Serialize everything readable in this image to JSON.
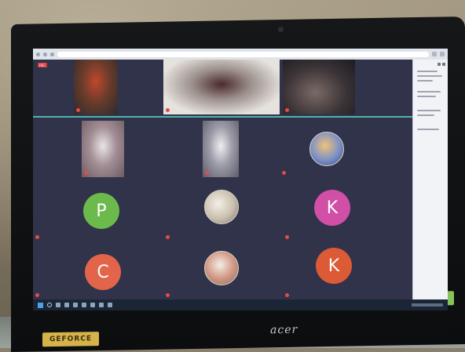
{
  "screen": {
    "recording_badge": "REC"
  },
  "participants": [
    {
      "kind": "video",
      "name": "",
      "video_color": "#6a3c2a"
    },
    {
      "kind": "video",
      "name": "",
      "video_color": "#cfcac4"
    },
    {
      "kind": "video",
      "name": "",
      "video_color": "#3b3336"
    },
    {
      "kind": "video",
      "name": "",
      "video_color": "#6e5b62"
    },
    {
      "kind": "video",
      "name": "",
      "video_color": "#5d5c6a"
    },
    {
      "kind": "photo",
      "name": ""
    },
    {
      "kind": "initial",
      "initial": "P",
      "name": "",
      "color": "#6cba4b"
    },
    {
      "kind": "photo",
      "name": ""
    },
    {
      "kind": "initial",
      "initial": "K",
      "name": "",
      "color": "#d14fa6"
    },
    {
      "kind": "initial",
      "initial": "C",
      "name": "",
      "color": "#e2644a"
    },
    {
      "kind": "photo",
      "name": ""
    },
    {
      "kind": "initial",
      "initial": "K",
      "name": "",
      "color": "#dc5a36"
    }
  ],
  "laptop": {
    "brand": "acer",
    "left_sticker": "GEFORCE",
    "right_sticker": ""
  },
  "colors": {
    "meeting_bg": "#303349",
    "mic_muted": "#e34b4b",
    "taskbar": "#1a2536"
  }
}
